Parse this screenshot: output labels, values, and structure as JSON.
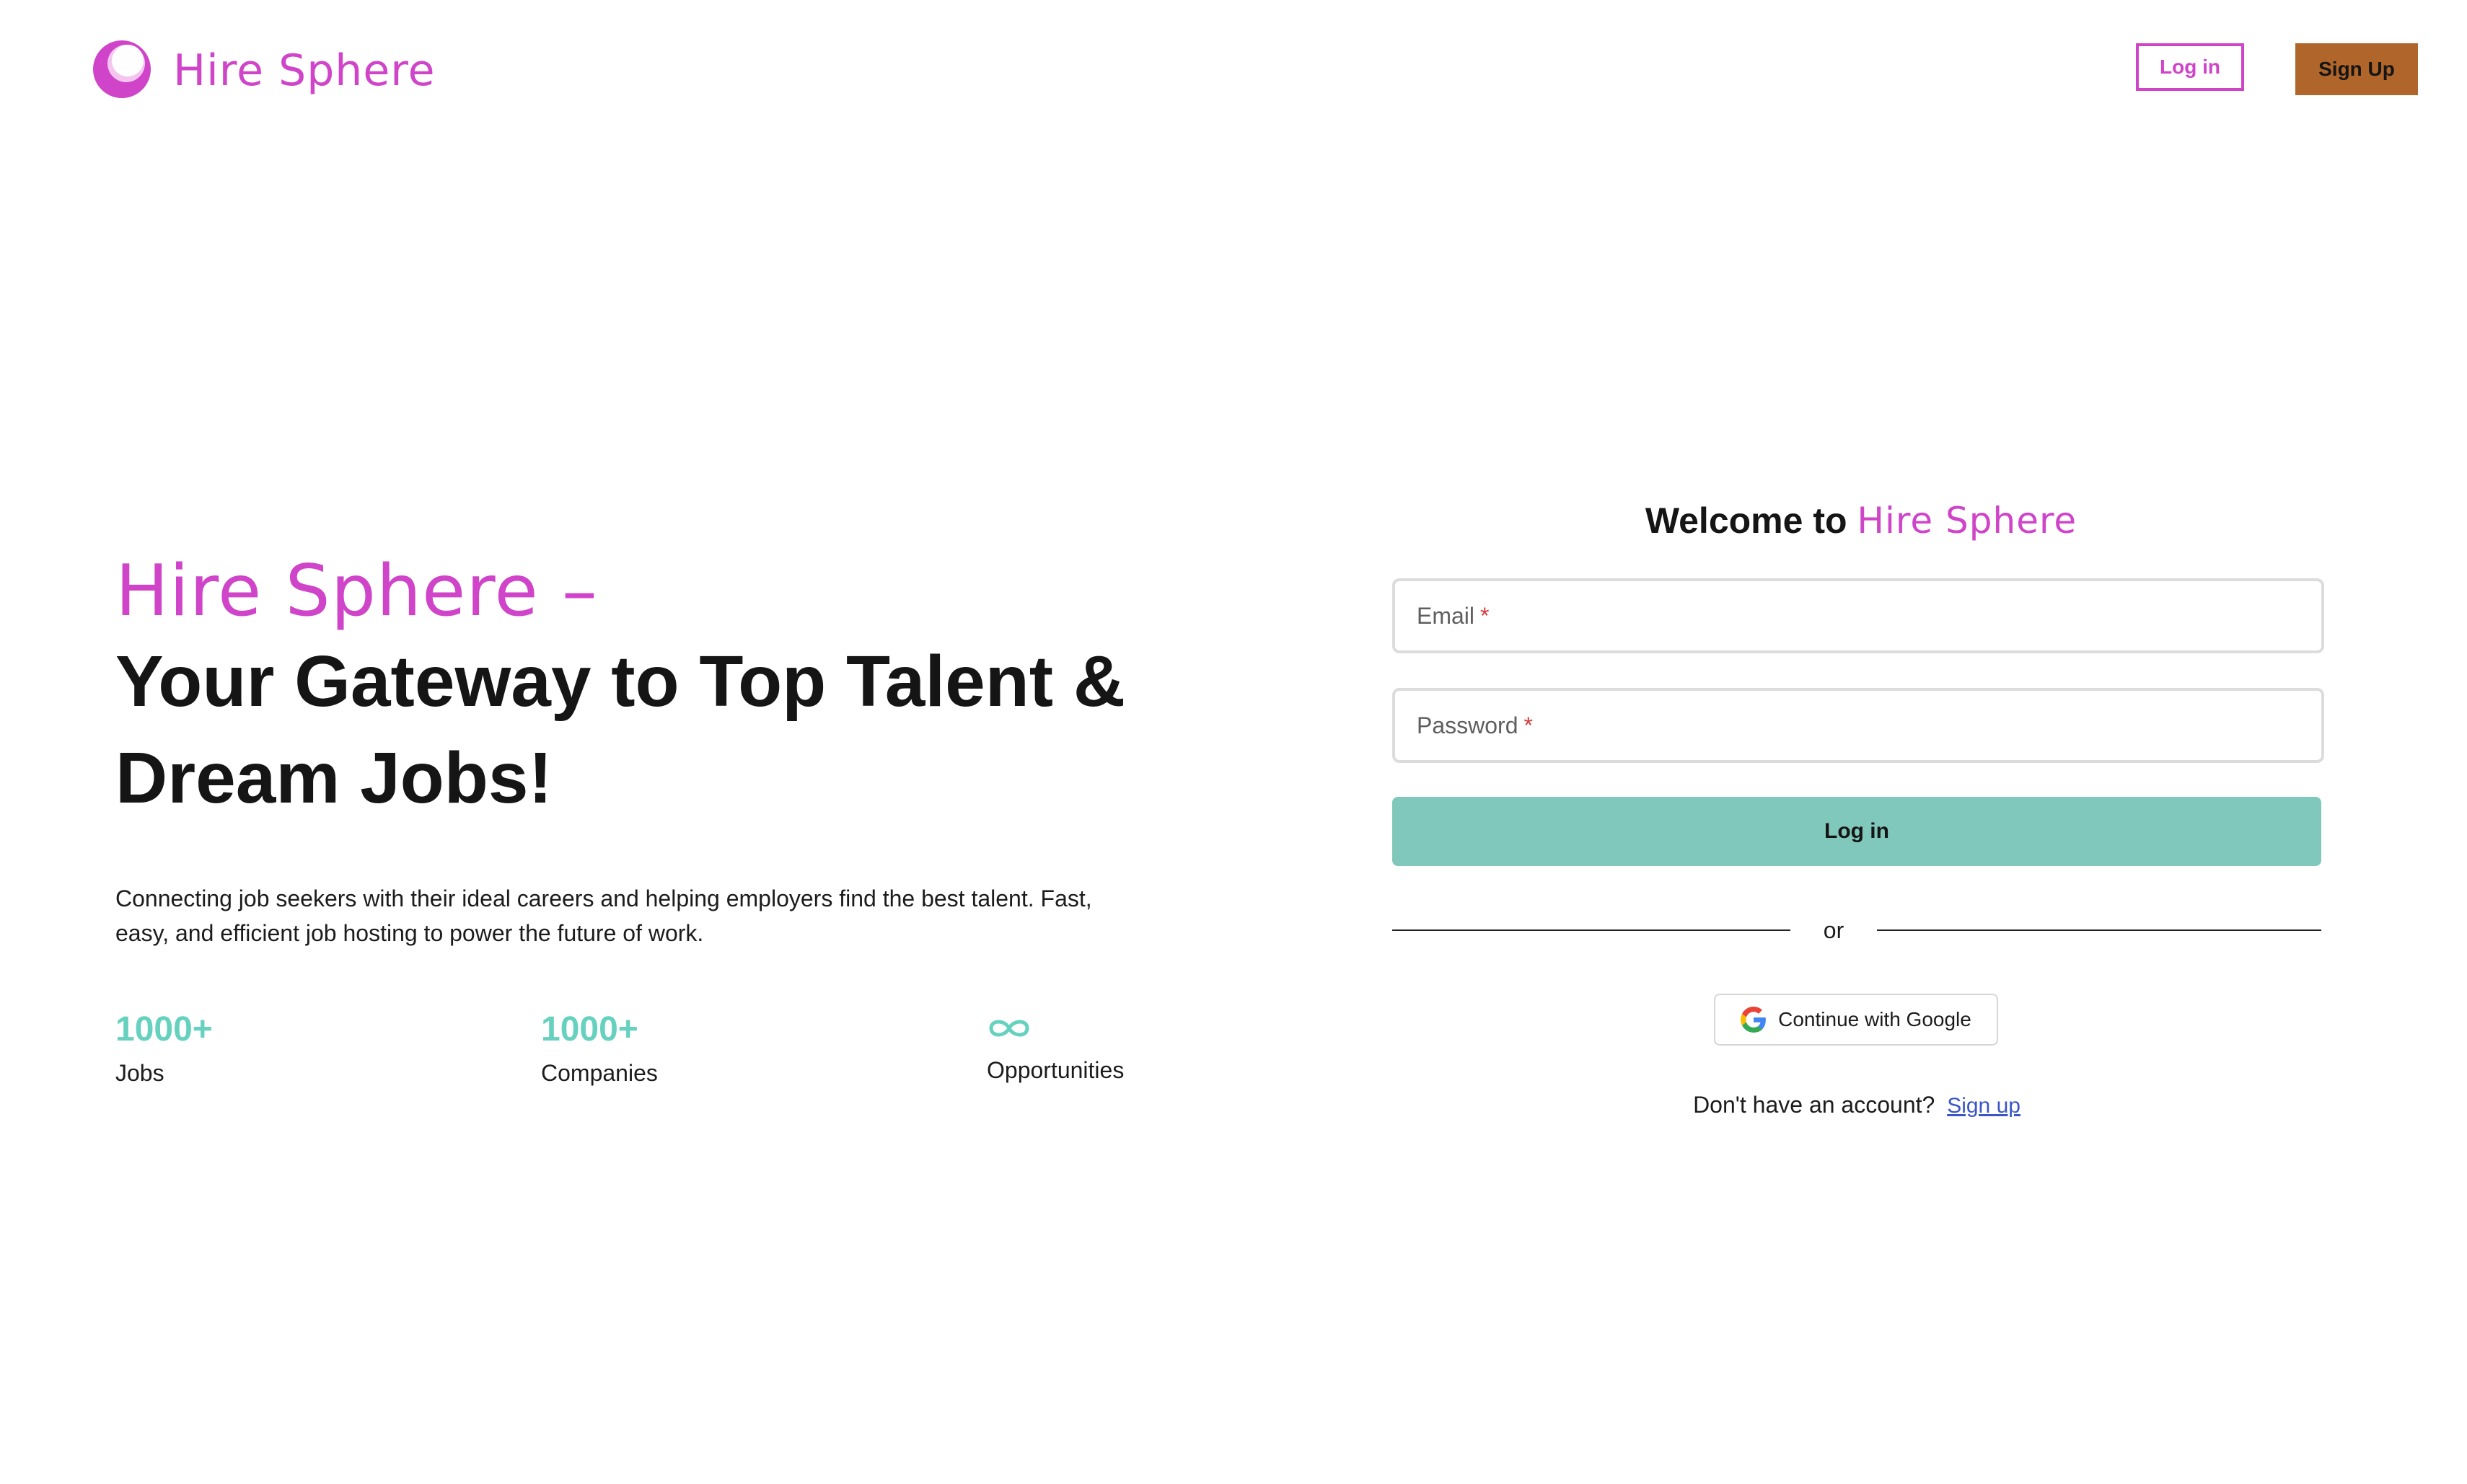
{
  "header": {
    "brand": "Hire Sphere",
    "login_label": "Log in",
    "signup_label": "Sign Up"
  },
  "hero": {
    "brand_line": "Hire Sphere –",
    "tagline": "Your Gateway to Top Talent & Dream Jobs!",
    "description": "Connecting job seekers with their ideal careers and helping employers find the best talent. Fast, easy, and efficient job hosting to power the future of work."
  },
  "stats": [
    {
      "value": "1000+",
      "label": "Jobs"
    },
    {
      "value": "1000+",
      "label": "Companies"
    },
    {
      "icon": "infinity-icon",
      "label": "Opportunities"
    }
  ],
  "login_form": {
    "welcome_prefix": "Welcome to",
    "welcome_brand": "Hire Sphere",
    "email_label": "Email",
    "password_label": "Password",
    "required_marker": "*",
    "submit_label": "Log in",
    "divider_text": "or",
    "google_label": "Continue with Google",
    "no_account_text": "Don't have an account?",
    "signup_link": "Sign up"
  },
  "colors": {
    "brand": "#cf44c8",
    "accent_teal": "#67d1bf",
    "login_button": "#80c8bb",
    "signup_button": "#b0652a",
    "link": "#3a56c5",
    "required": "#d33a3a"
  }
}
